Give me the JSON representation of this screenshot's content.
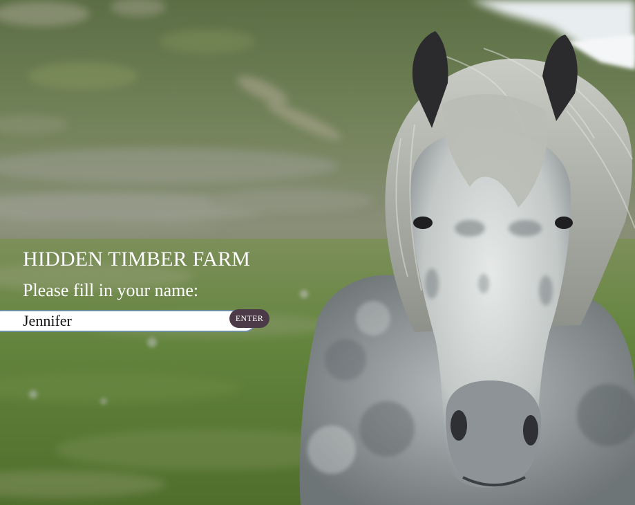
{
  "header": {
    "title": "HIDDEN TIMBER FARM"
  },
  "form": {
    "prompt": "Please fill in your name:",
    "name_value": "Jennifer",
    "enter_label": "ENTER"
  },
  "background": {
    "subject": "grey dappled horse in a green mountain valley",
    "colors": {
      "grass": "#5f7a3e",
      "hillside": "#6d7e58",
      "sky": "#e9eef0",
      "button": "#4d3a48",
      "input_border": "#6f8fa2"
    }
  }
}
